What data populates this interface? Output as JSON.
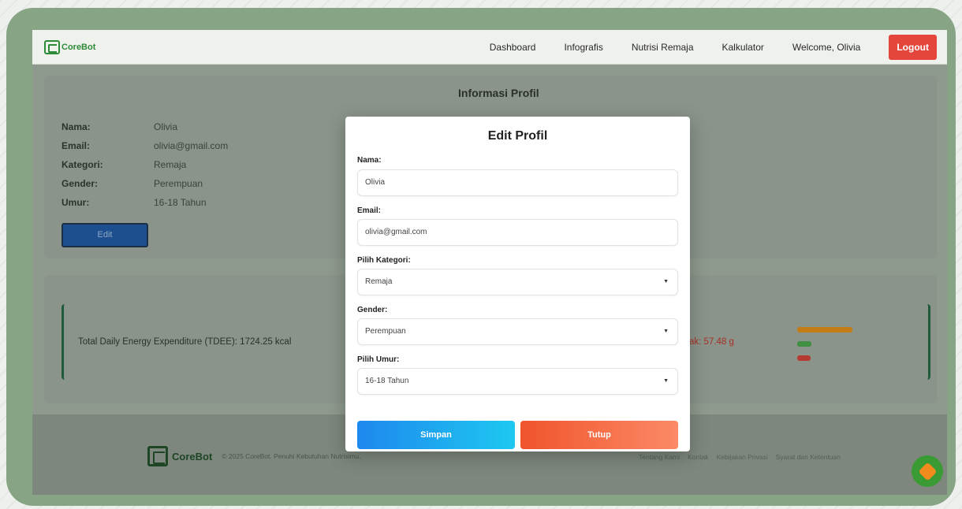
{
  "nav": {
    "logo": "CoreBot",
    "links": [
      "Dashboard",
      "Infografis",
      "Nutrisi Remaja",
      "Kalkulator"
    ],
    "welcome": "Welcome, Olivia",
    "logout": "Logout"
  },
  "profile": {
    "title": "Informasi Profil",
    "fields": [
      {
        "label": "Nama:",
        "value": "Olivia"
      },
      {
        "label": "Email:",
        "value": "olivia@gmail.com"
      },
      {
        "label": "Kategori:",
        "value": "Remaja"
      },
      {
        "label": "Gender:",
        "value": "Perempuan"
      },
      {
        "label": "Umur:",
        "value": "16-18 Tahun"
      }
    ],
    "edit_button": "Edit"
  },
  "tdee": {
    "label": "Total Daily Energy Expenditure (TDEE):",
    "value": "1724.25 kcal",
    "fat_label": "emak:",
    "fat_value": "57.48 g",
    "bar_colors": [
      "#c47d14",
      "#3f8f45",
      "#b53a31"
    ]
  },
  "modal": {
    "title": "Edit Profil",
    "name_label": "Nama:",
    "name_value": "Olivia",
    "email_label": "Email:",
    "email_value": "olivia@gmail.com",
    "category_label": "Pilih Kategori:",
    "category_value": "Remaja",
    "gender_label": "Gender:",
    "gender_value": "Perempuan",
    "age_label": "Pilih Umur:",
    "age_value": "16-18 Tahun",
    "save_button": "Simpan",
    "close_button": "Tutup"
  },
  "footer": {
    "logo": "CoreBot",
    "copyright": "© 2025 CoreBot. Penuhi Kebutuhan Nutrisimu.",
    "links": [
      "Tentang Kami",
      "Kontak",
      "Kebijakan Privasi",
      "Syarat dan Ketentuan"
    ]
  },
  "colors": {
    "accent_green": "#2e8b3a",
    "logout_red": "#e5463c",
    "save_gradient": [
      "#1e88ee",
      "#1ec8f0"
    ],
    "close_gradient": [
      "#f0542c",
      "#fb8a66"
    ]
  }
}
